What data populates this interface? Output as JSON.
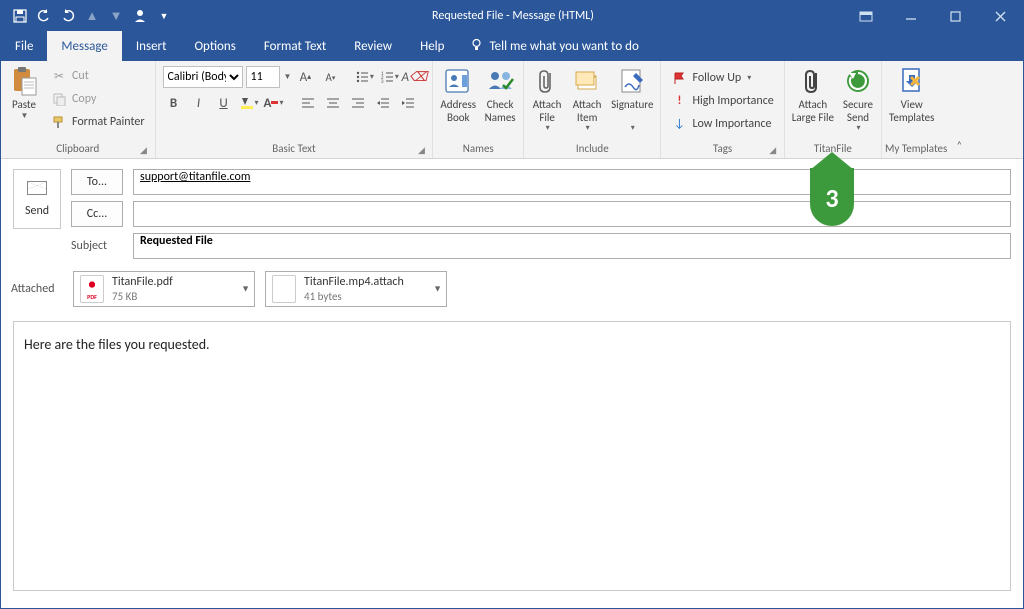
{
  "window": {
    "title": "Requested File  -  Message (HTML)"
  },
  "tabs": {
    "file": "File",
    "message": "Message",
    "insert": "Insert",
    "options": "Options",
    "format_text": "Format Text",
    "review": "Review",
    "help": "Help",
    "tellme": "Tell me what you want to do"
  },
  "ribbon": {
    "clipboard": {
      "label": "Clipboard",
      "paste": "Paste",
      "cut": "Cut",
      "copy": "Copy",
      "format_painter": "Format Painter"
    },
    "basic_text": {
      "label": "Basic Text",
      "font": "Calibri (Body)",
      "size": "11"
    },
    "names": {
      "label": "Names",
      "address_book": "Address\nBook",
      "check_names": "Check\nNames"
    },
    "include": {
      "label": "Include",
      "attach_file": "Attach\nFile",
      "attach_item": "Attach\nItem",
      "signature": "Signature"
    },
    "tags": {
      "label": "Tags",
      "follow_up": "Follow Up",
      "high_importance": "High Importance",
      "low_importance": "Low Importance"
    },
    "titanfile": {
      "label": "TitanFile",
      "attach_large_file": "Attach\nLarge File",
      "secure_send": "Secure\nSend"
    },
    "my_templates": {
      "label": "My Templates",
      "view_templates": "View\nTemplates"
    }
  },
  "compose": {
    "send": "Send",
    "to_label": "To...",
    "to_value": "support@titanfile.com",
    "cc_label": "Cc...",
    "cc_value": "",
    "subject_label": "Subject",
    "subject_value": "Requested File",
    "attached_label": "Attached",
    "attachments": [
      {
        "name": "TitanFile.pdf",
        "size": "75 KB",
        "kind": "pdf"
      },
      {
        "name": "TitanFile.mp4.attach",
        "size": "41 bytes",
        "kind": "generic"
      }
    ],
    "body": "Here are the files you requested."
  },
  "callout": {
    "number": "3"
  }
}
